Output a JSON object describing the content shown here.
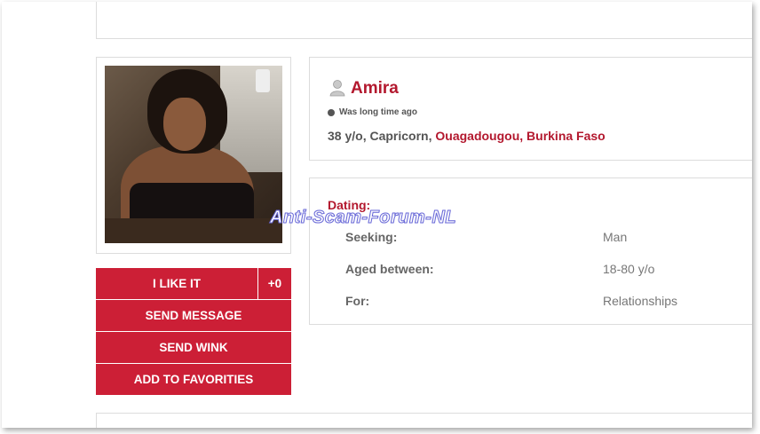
{
  "profile": {
    "name": "Amira",
    "status": "Was long time ago",
    "details_prefix": "38 y/o, Capricorn, ",
    "location": "Ouagadougou, Burkina Faso"
  },
  "actions": {
    "like_label": "I LIKE IT",
    "like_count": "+0",
    "message_label": "SEND MESSAGE",
    "wink_label": "SEND WINK",
    "favorites_label": "ADD TO FAVORITIES"
  },
  "dating": {
    "title": "Dating:",
    "rows": [
      {
        "label": "Seeking:",
        "value": "Man"
      },
      {
        "label": "Aged between:",
        "value": "18-80 y/o"
      },
      {
        "label": "For:",
        "value": "Relationships"
      }
    ]
  },
  "watermark": "Anti-Scam-Forum-NL",
  "colors": {
    "accent": "#cc1f36",
    "name": "#b3182e",
    "border": "#dcdcdc"
  },
  "icons": {
    "user": "user-silhouette-icon",
    "status": "status-dot-icon"
  }
}
